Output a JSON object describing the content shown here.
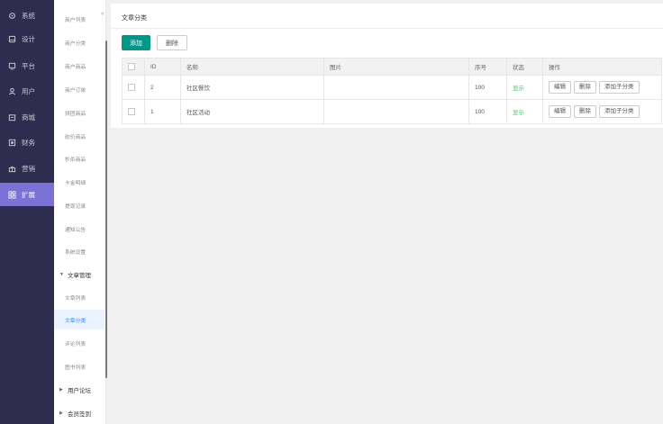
{
  "sidebar_primary": [
    {
      "label": "系统",
      "icon": "gear-icon"
    },
    {
      "label": "设计",
      "icon": "design-icon"
    },
    {
      "label": "平台",
      "icon": "platform-icon"
    },
    {
      "label": "用户",
      "icon": "user-icon"
    },
    {
      "label": "商城",
      "icon": "shop-icon"
    },
    {
      "label": "财务",
      "icon": "finance-icon"
    },
    {
      "label": "营销",
      "icon": "marketing-icon"
    },
    {
      "label": "扩展",
      "icon": "extend-icon",
      "active": true
    }
  ],
  "sidebar_secondary": {
    "items": [
      "商户列表",
      "商户分类",
      "商户商品",
      "商户订单",
      "拼团商品",
      "砍价商品",
      "秒杀商品",
      "卡金明细",
      "提现记录",
      "通知公告",
      "系统设置"
    ],
    "group_article": "文章管理",
    "article_items": [
      "文章列表",
      "文章分类",
      "评论列表",
      "图书列表"
    ],
    "group_forum": "用户论坛",
    "group_checkin": "会员签到",
    "collapse_symbol": "«"
  },
  "page": {
    "title": "文章分类",
    "add_label": "添加",
    "delete_label": "删除"
  },
  "table": {
    "headers": [
      "ID",
      "名称",
      "图片",
      "序号",
      "状态",
      "操作"
    ],
    "rows": [
      {
        "id": "2",
        "name": "社区餐饮",
        "image": "",
        "order": "100",
        "status": "显示",
        "actions": [
          "编辑",
          "删除",
          "添加子分类"
        ]
      },
      {
        "id": "1",
        "name": "社区活动",
        "image": "",
        "order": "100",
        "status": "显示",
        "actions": [
          "编辑",
          "删除",
          "添加子分类"
        ]
      }
    ]
  },
  "colors": {
    "sidebar_bg": "#2f2d4f",
    "sidebar_active": "#7b72d6",
    "primary_button": "#009688",
    "active_submenu_text": "#2e86f0",
    "status_on": "#5fb878"
  }
}
